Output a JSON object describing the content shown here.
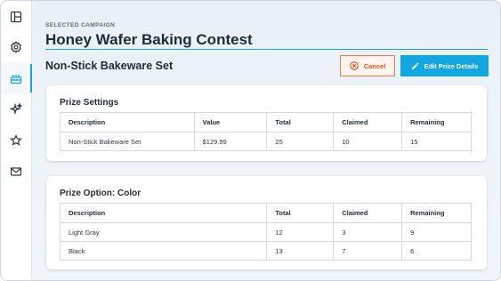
{
  "sidebar": {
    "items": [
      {
        "icon": "layout-icon"
      },
      {
        "icon": "gear-icon"
      },
      {
        "icon": "cake-icon",
        "active": true
      },
      {
        "icon": "sparkles-icon"
      },
      {
        "icon": "star-icon"
      },
      {
        "icon": "mail-icon"
      }
    ]
  },
  "header": {
    "eyebrow": "SELECTED CAMPAIGN",
    "campaign_title": "Honey Wafer Baking Contest",
    "prize_name": "Non-Stick Bakeware Set"
  },
  "actions": {
    "cancel_label": "Cancel",
    "edit_label": "Edit Prize Details"
  },
  "prize_settings": {
    "title": "Prize Settings",
    "columns": [
      "Description",
      "Value",
      "Total",
      "Claimed",
      "Remaining"
    ],
    "rows": [
      [
        "Non-Stick Bakeware Set",
        "$129.99",
        "25",
        "10",
        "15"
      ]
    ]
  },
  "prize_option": {
    "title": "Prize Option: Color",
    "columns": [
      "Description",
      "Total",
      "Claimed",
      "Remaining"
    ],
    "rows": [
      [
        "Light Gray",
        "12",
        "3",
        "9"
      ],
      [
        "Black",
        "13",
        "7",
        "6"
      ]
    ]
  },
  "colors": {
    "accent": "#12a7e0",
    "cancel": "#d9531e"
  }
}
